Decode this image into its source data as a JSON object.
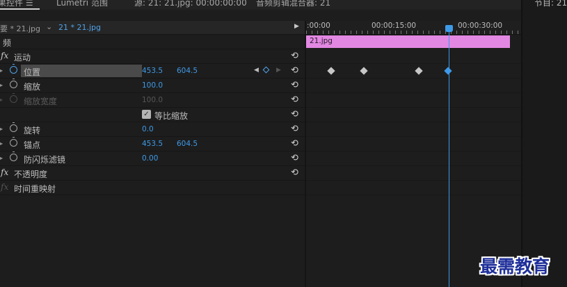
{
  "header": {
    "tabs": [
      {
        "label": "果控件 ☰"
      },
      {
        "label": "Lumetri 范围"
      },
      {
        "label": "源: 21: 21.jpg: 00:00:00:00"
      },
      {
        "label": "音频剪辑混合器: 21"
      }
    ],
    "right_tab": "节目: 21"
  },
  "source_row": {
    "master": "要 * 21.jpg",
    "chevron": "⌄",
    "sequence": "21 * 21.jpg",
    "play": "▶"
  },
  "effects": {
    "section_video": "频",
    "motion": "运动",
    "position": {
      "label": "位置",
      "x": "453.5",
      "y": "604.5"
    },
    "scale": {
      "label": "缩放",
      "value": "100.0"
    },
    "scale_width": {
      "label": "缩放宽度",
      "value": "100.0"
    },
    "uniform_scale": {
      "label": "等比缩放",
      "checked": true
    },
    "rotation": {
      "label": "旋转",
      "value": "0.0"
    },
    "anchor": {
      "label": "锚点",
      "x": "453.5",
      "y": "604.5"
    },
    "anti_flicker": {
      "label": "防闪烁滤镜",
      "value": "0.00"
    },
    "opacity": "不透明度",
    "time_remap": "时间重映射",
    "fx_symbol": "fx",
    "reset_symbol": "⟲"
  },
  "timeline": {
    "ruler": [
      ":00:00",
      "00:00:15:00",
      "00:00:30:00"
    ],
    "clip_name": "21.jpg",
    "keyframes": [
      476,
      523,
      602,
      644
    ],
    "selected_keyframe": 3,
    "accent": "#3e9ae8",
    "clip_color": "#e288e2"
  },
  "watermark": "最需教育"
}
